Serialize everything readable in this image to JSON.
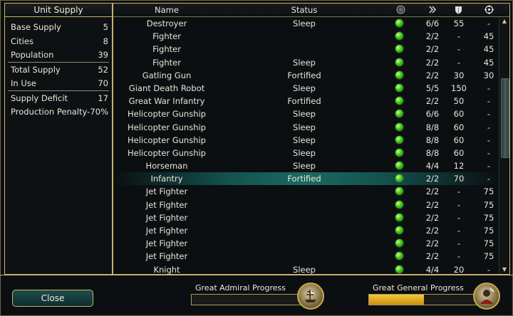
{
  "supply": {
    "title": "Unit Supply",
    "rows": [
      {
        "label": "Base Supply",
        "value": "5"
      },
      {
        "label": "Cities",
        "value": "8"
      },
      {
        "label": "Population",
        "value": "39"
      },
      {
        "label": "Total Supply",
        "value": "52"
      },
      {
        "label": "In Use",
        "value": "70"
      },
      {
        "label": "Supply Deficit",
        "value": "17"
      },
      {
        "label": "Production Penalty",
        "value": "-70%"
      }
    ]
  },
  "table": {
    "headers": {
      "name": "Name",
      "status": "Status",
      "icons": [
        "health-icon",
        "moves-icon",
        "strength-icon",
        "ranged-icon"
      ]
    },
    "units": [
      {
        "name": "Destroyer",
        "status": "Sleep",
        "moves": "6/6",
        "strength": "55",
        "ranged": "-"
      },
      {
        "name": "Fighter",
        "status": "",
        "moves": "2/2",
        "strength": "-",
        "ranged": "45"
      },
      {
        "name": "Fighter",
        "status": "",
        "moves": "2/2",
        "strength": "-",
        "ranged": "45"
      },
      {
        "name": "Fighter",
        "status": "Sleep",
        "moves": "2/2",
        "strength": "-",
        "ranged": "45"
      },
      {
        "name": "Gatling Gun",
        "status": "Fortified",
        "moves": "2/2",
        "strength": "30",
        "ranged": "30"
      },
      {
        "name": "Giant Death Robot",
        "status": "Sleep",
        "moves": "5/5",
        "strength": "150",
        "ranged": "-"
      },
      {
        "name": "Great War Infantry",
        "status": "Fortified",
        "moves": "2/2",
        "strength": "50",
        "ranged": "-"
      },
      {
        "name": "Helicopter Gunship",
        "status": "Sleep",
        "moves": "6/6",
        "strength": "60",
        "ranged": "-"
      },
      {
        "name": "Helicopter Gunship",
        "status": "Sleep",
        "moves": "8/8",
        "strength": "60",
        "ranged": "-"
      },
      {
        "name": "Helicopter Gunship",
        "status": "Sleep",
        "moves": "8/8",
        "strength": "60",
        "ranged": "-"
      },
      {
        "name": "Helicopter Gunship",
        "status": "Sleep",
        "moves": "8/8",
        "strength": "60",
        "ranged": "-"
      },
      {
        "name": "Horseman",
        "status": "Sleep",
        "moves": "4/4",
        "strength": "12",
        "ranged": "-"
      },
      {
        "name": "Infantry",
        "status": "Fortified",
        "moves": "2/2",
        "strength": "70",
        "ranged": "-",
        "selected": true
      },
      {
        "name": "Jet Fighter",
        "status": "",
        "moves": "2/2",
        "strength": "-",
        "ranged": "75"
      },
      {
        "name": "Jet Fighter",
        "status": "",
        "moves": "2/2",
        "strength": "-",
        "ranged": "75"
      },
      {
        "name": "Jet Fighter",
        "status": "",
        "moves": "2/2",
        "strength": "-",
        "ranged": "75"
      },
      {
        "name": "Jet Fighter",
        "status": "",
        "moves": "2/2",
        "strength": "-",
        "ranged": "75"
      },
      {
        "name": "Jet Fighter",
        "status": "",
        "moves": "2/2",
        "strength": "-",
        "ranged": "75"
      },
      {
        "name": "Jet Fighter",
        "status": "",
        "moves": "2/2",
        "strength": "-",
        "ranged": "75"
      },
      {
        "name": "Knight",
        "status": "Sleep",
        "moves": "4/4",
        "strength": "20",
        "ranged": "-"
      }
    ]
  },
  "footer": {
    "close_label": "Close",
    "admiral": {
      "label": "Great Admiral Progress",
      "progress": 0.0,
      "icon": "admiral-ship-icon"
    },
    "general": {
      "label": "Great General Progress",
      "progress": 0.45,
      "icon": "general-icon"
    }
  },
  "colors": {
    "frame": "#c9b36a",
    "selected_row": "#1b6962",
    "status_dot": "#43c21f",
    "progress_fill": "#e0a820"
  }
}
